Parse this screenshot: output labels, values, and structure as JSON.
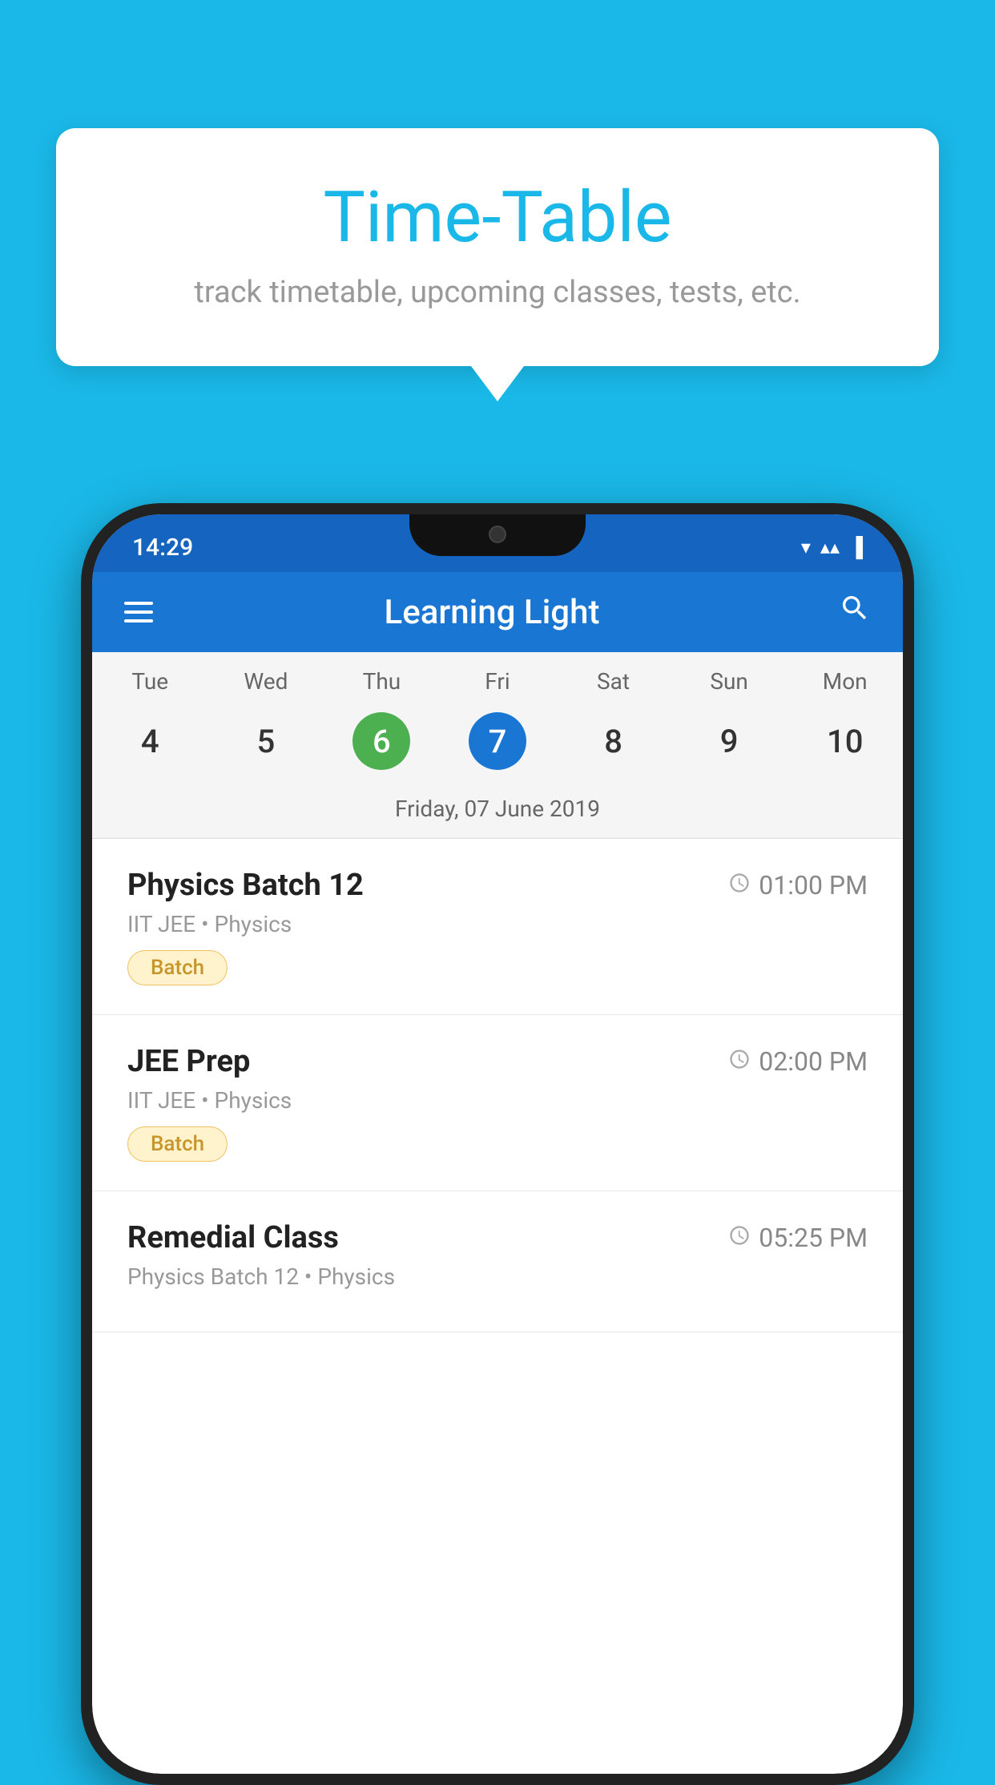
{
  "background_color": "#1ab8e8",
  "tooltip": {
    "title": "Time-Table",
    "subtitle": "track timetable, upcoming classes, tests, etc."
  },
  "status_bar": {
    "time": "14:29"
  },
  "app_bar": {
    "title": "Learning Light"
  },
  "calendar": {
    "days": [
      "Tue",
      "Wed",
      "Thu",
      "Fri",
      "Sat",
      "Sun",
      "Mon"
    ],
    "numbers": [
      "4",
      "5",
      "6",
      "7",
      "8",
      "9",
      "10"
    ],
    "today_index": 2,
    "selected_index": 3,
    "date_label": "Friday, 07 June 2019"
  },
  "schedule": {
    "items": [
      {
        "title": "Physics Batch 12",
        "time": "01:00 PM",
        "subtitle": "IIT JEE • Physics",
        "badge": "Batch"
      },
      {
        "title": "JEE Prep",
        "time": "02:00 PM",
        "subtitle": "IIT JEE • Physics",
        "badge": "Batch"
      },
      {
        "title": "Remedial Class",
        "time": "05:25 PM",
        "subtitle": "Physics Batch 12 • Physics",
        "badge": null
      }
    ]
  },
  "labels": {
    "menu_icon": "≡",
    "search_icon": "🔍",
    "clock_symbol": "🕐"
  }
}
